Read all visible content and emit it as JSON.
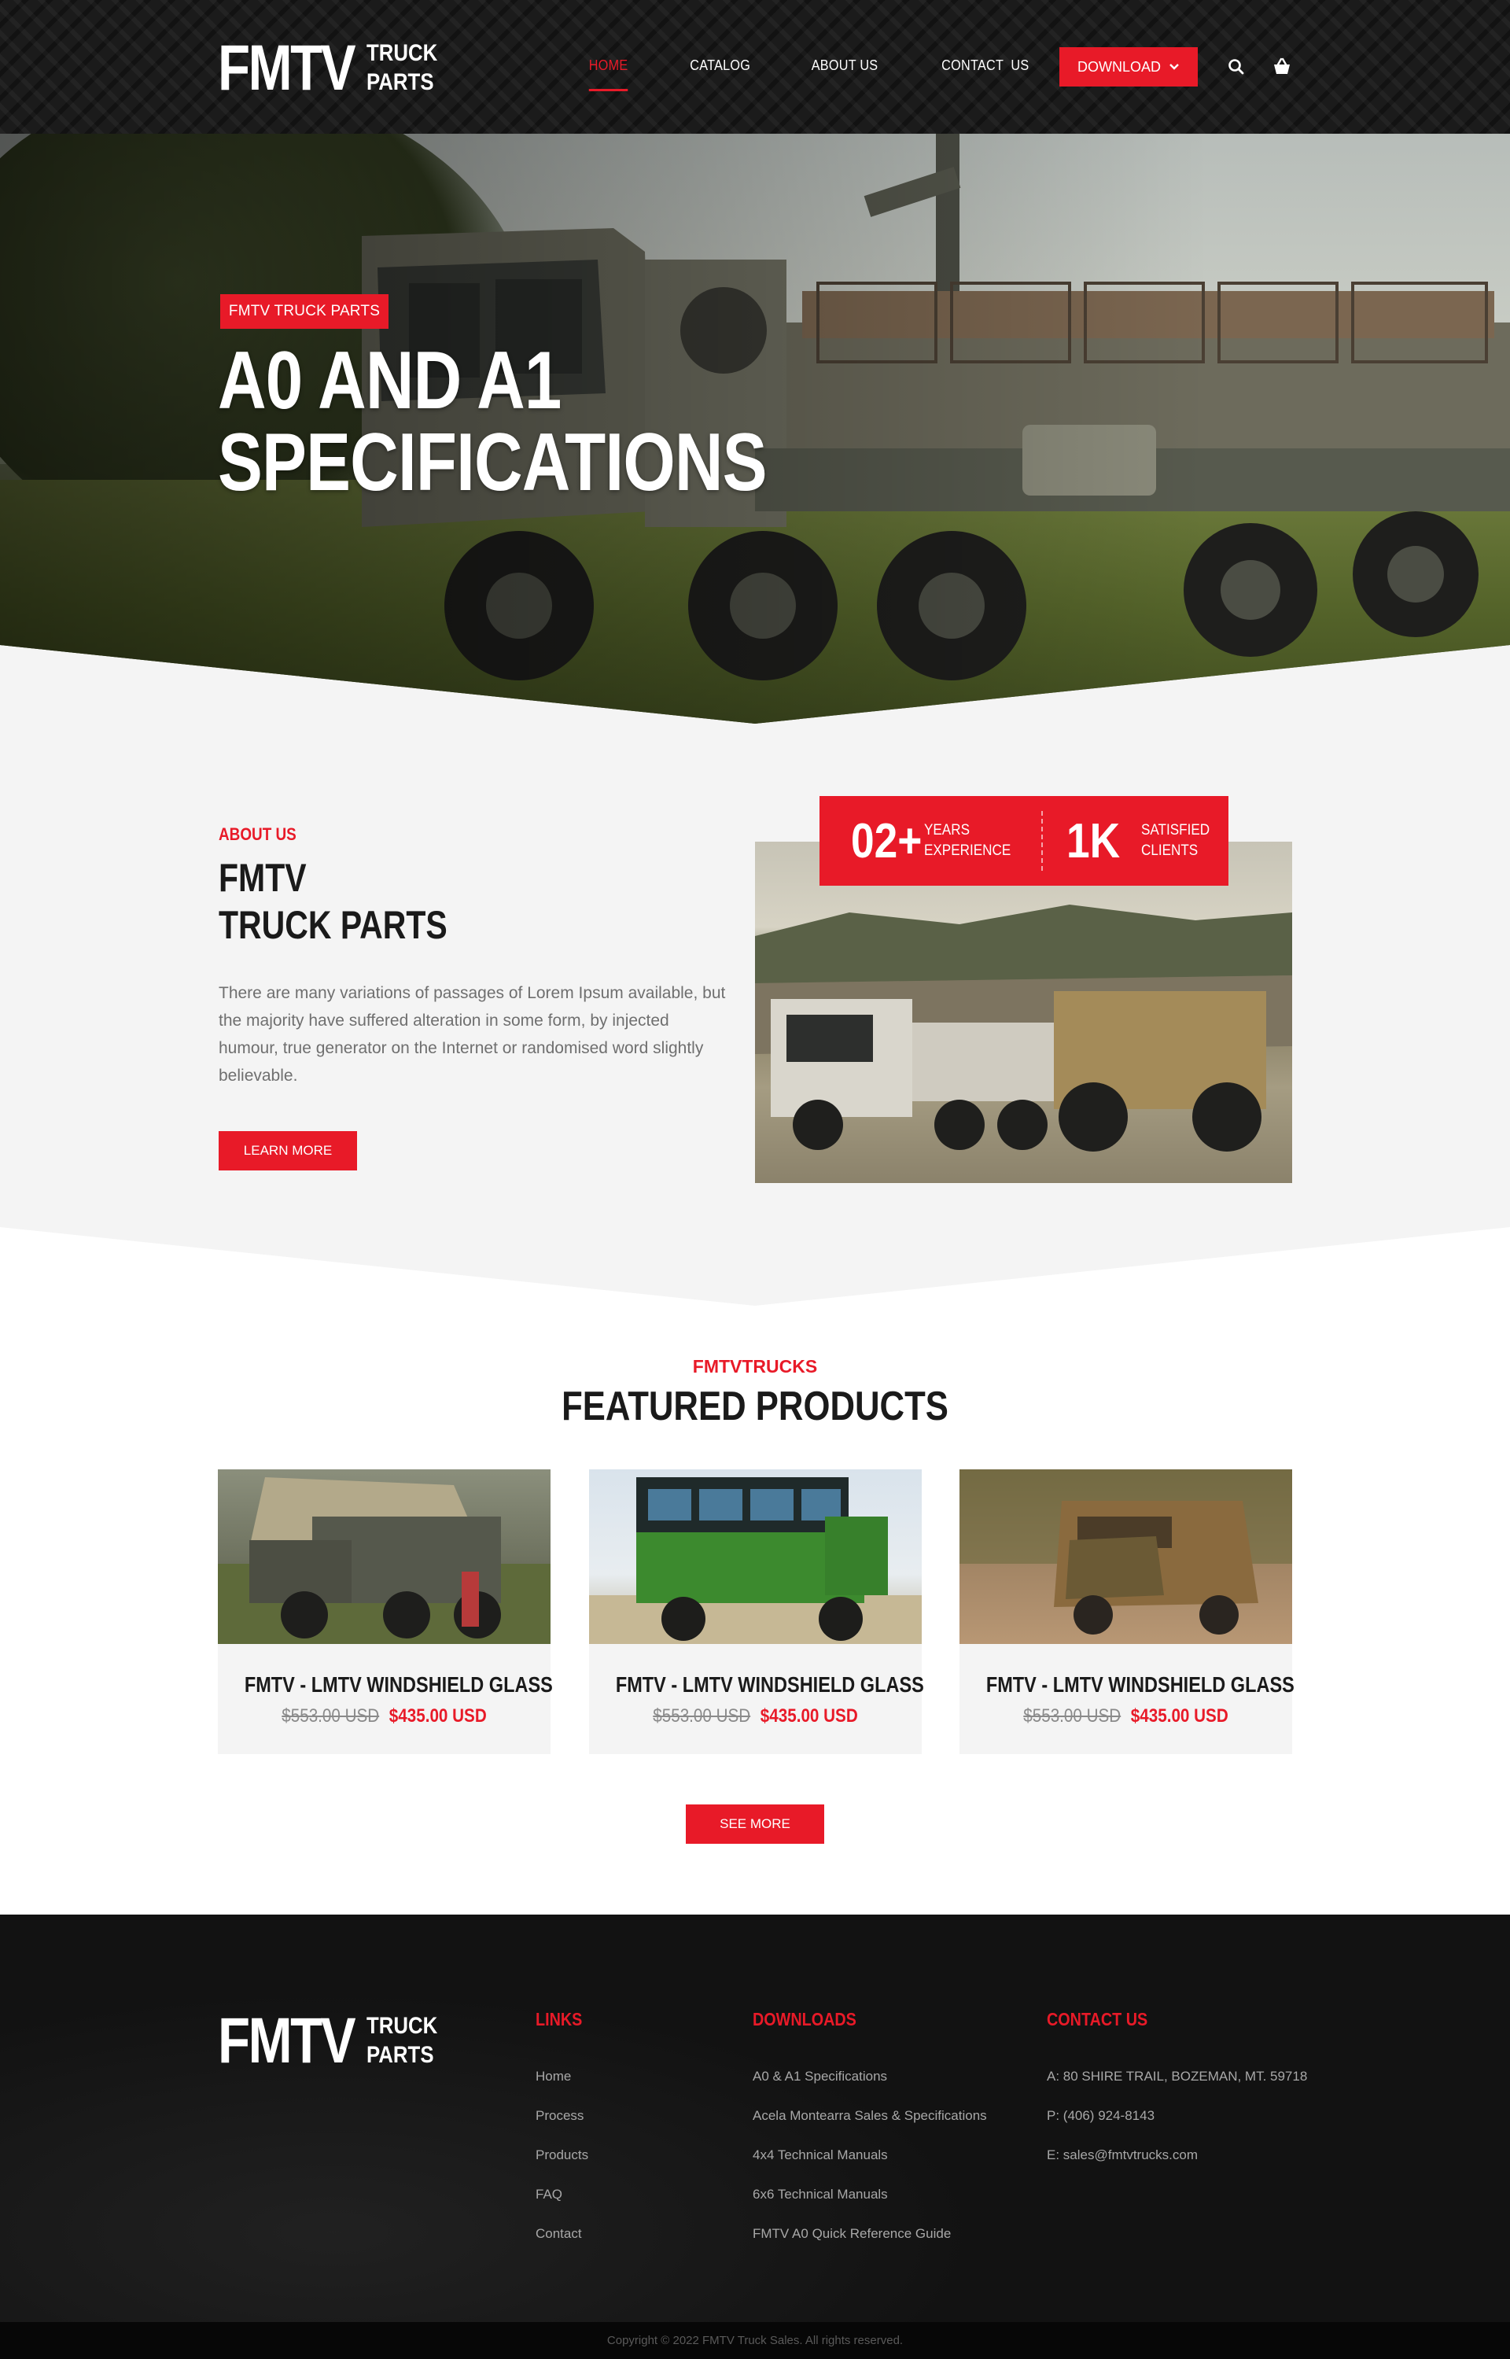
{
  "brand": {
    "logo_big": "FMTV",
    "logo_small_1": "TRUCK",
    "logo_small_2": "PARTS",
    "accent": "#e81a28"
  },
  "nav": {
    "items": [
      {
        "label": "HOME",
        "active": true
      },
      {
        "label": "CATALOG"
      },
      {
        "label": "ABOUT US"
      },
      {
        "label": "CONTACT  US"
      }
    ],
    "download_label": "DOWNLOAD",
    "icons": [
      "search-icon",
      "cart-icon",
      "chevron-down-icon"
    ]
  },
  "hero": {
    "tag": "FMTV TRUCK PARTS",
    "title_line1": "A0 AND A1",
    "title_line2": "SPECIFICATIONS"
  },
  "about": {
    "label": "ABOUT US",
    "title_line1": "FMTV",
    "title_line2": "TRUCK PARTS",
    "text": "There are many variations of passages of Lorem Ipsum available, but the majority have suffered alteration in some form, by injected humour, true generator on the Internet or randomised word slightly believable.",
    "button": "LEARN MORE",
    "stats": [
      {
        "value": "02+",
        "label_1": "YEARS",
        "label_2": "EXPERIENCE"
      },
      {
        "value": "1K",
        "label_1": "SATISFIED",
        "label_2": "CLIENTS"
      }
    ]
  },
  "products": {
    "label": "FMTVTRUCKS",
    "title": "FEATURED PRODUCTS",
    "items": [
      {
        "name": "FMTV - LMTV WINDSHIELD GLASS",
        "old_price": "$553.00 USD",
        "new_price": "$435.00 USD"
      },
      {
        "name": "FMTV - LMTV WINDSHIELD GLASS",
        "old_price": "$553.00 USD",
        "new_price": "$435.00 USD"
      },
      {
        "name": "FMTV - LMTV WINDSHIELD GLASS",
        "old_price": "$553.00 USD",
        "new_price": "$435.00 USD"
      }
    ],
    "button": "SEE MORE"
  },
  "footer": {
    "links_head": "LINKS",
    "links": [
      "Home",
      "Process",
      "Products",
      "FAQ",
      "Contact"
    ],
    "downloads_head": "DOWNLOADS",
    "downloads": [
      "A0 & A1 Specifications",
      "Acela Montearra Sales & Specifications",
      "4x4 Technical Manuals",
      "6x6 Technical Manuals",
      "FMTV A0 Quick Reference Guide"
    ],
    "contact_head": "CONTACT US",
    "contact": [
      "A: 80 SHIRE TRAIL, BOZEMAN, MT. 59718",
      "P: (406) 924-8143",
      "E: sales@fmtvtrucks.com"
    ],
    "copyright": "Copyright © 2022 FMTV Truck Sales. All rights reserved."
  }
}
